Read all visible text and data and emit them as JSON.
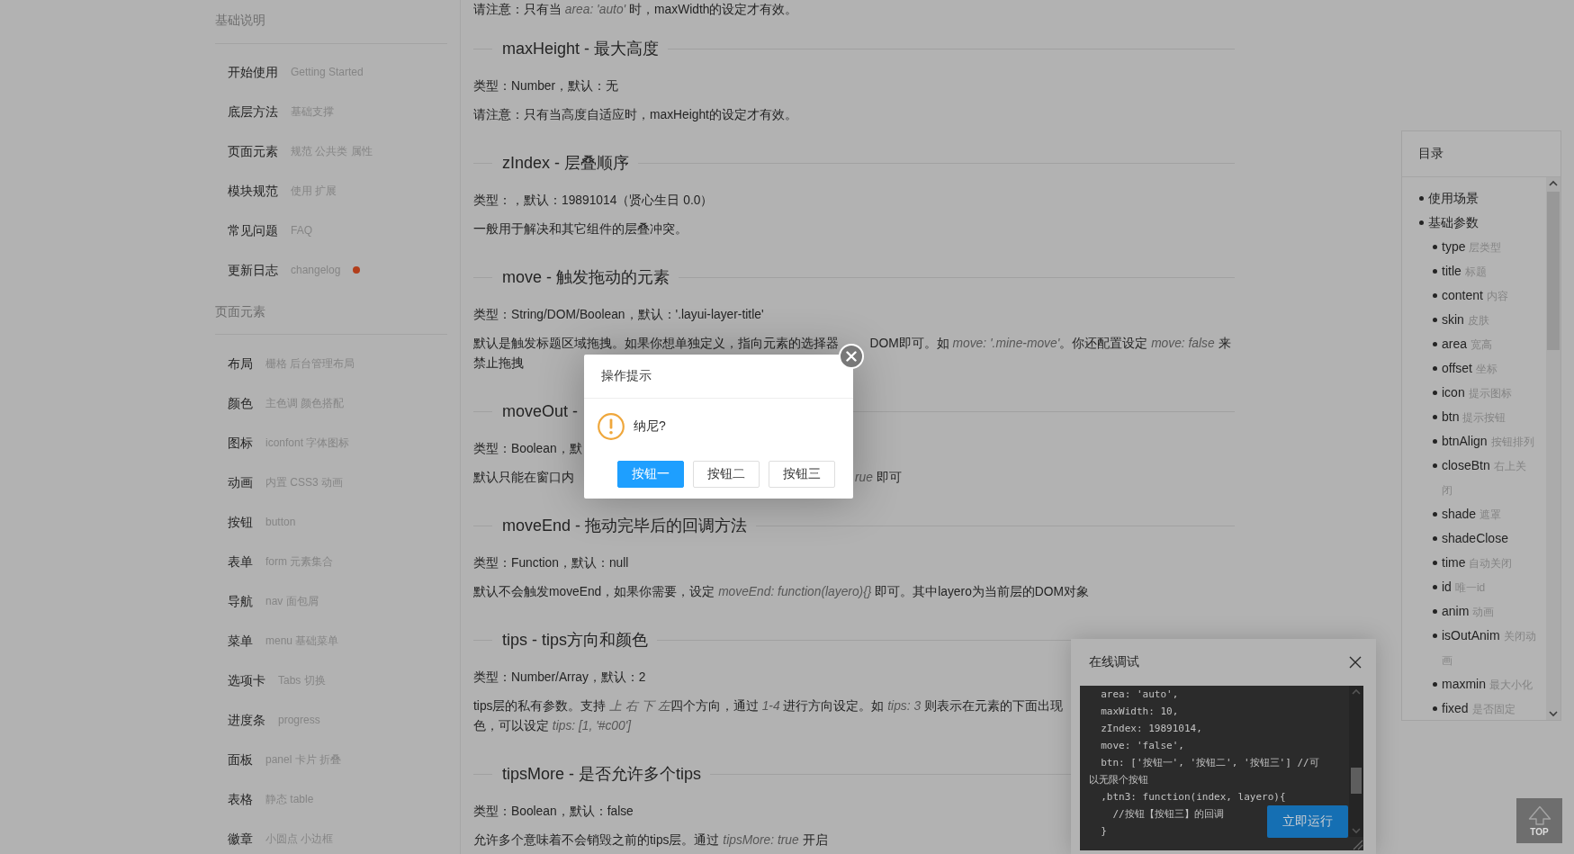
{
  "sidebar": {
    "groups": [
      {
        "title": "基础说明",
        "items": [
          {
            "label": "开始使用",
            "hint": "Getting Started",
            "dot": false
          },
          {
            "label": "底层方法",
            "hint": "基础支撑",
            "dot": false
          },
          {
            "label": "页面元素",
            "hint": "规范 公共类 属性",
            "dot": false
          },
          {
            "label": "模块规范",
            "hint": "使用 扩展",
            "dot": false
          },
          {
            "label": "常见问题",
            "hint": "FAQ",
            "dot": false
          },
          {
            "label": "更新日志",
            "hint": "changelog",
            "dot": true
          }
        ]
      },
      {
        "title": "页面元素",
        "items": [
          {
            "label": "布局",
            "hint": "栅格 后台管理布局",
            "dot": false
          },
          {
            "label": "颜色",
            "hint": "主色调 颜色搭配",
            "dot": false
          },
          {
            "label": "图标",
            "hint": "iconfont 字体图标",
            "dot": false
          },
          {
            "label": "动画",
            "hint": "内置 CSS3 动画",
            "dot": false
          },
          {
            "label": "按钮",
            "hint": "button",
            "dot": false
          },
          {
            "label": "表单",
            "hint": "form 元素集合",
            "dot": false
          },
          {
            "label": "导航",
            "hint": "nav 面包屑",
            "dot": false
          },
          {
            "label": "菜单",
            "hint": "menu 基础菜单",
            "dot": false
          },
          {
            "label": "选项卡",
            "hint": "Tabs 切换",
            "dot": false
          },
          {
            "label": "进度条",
            "hint": "progress",
            "dot": false
          },
          {
            "label": "面板",
            "hint": "panel 卡片 折叠",
            "dot": false
          },
          {
            "label": "表格",
            "hint": "静态 table",
            "dot": false
          },
          {
            "label": "徽章",
            "hint": "小圆点 小边框",
            "dot": false
          }
        ]
      }
    ]
  },
  "content": {
    "blocks": [
      {
        "kind": "paragraph",
        "text": "请注意：只有当 *area: 'auto'* 时，maxWidth的设定才有效。"
      },
      {
        "kind": "heading",
        "text": "maxHeight - 最大高度"
      },
      {
        "kind": "paragraph",
        "text": "类型：Number，默认：无"
      },
      {
        "kind": "paragraph",
        "text": "请注意：只有当高度自适应时，maxHeight的设定才有效。"
      },
      {
        "kind": "heading",
        "text": "zIndex - 层叠顺序"
      },
      {
        "kind": "paragraph",
        "text": "类型：，默认：19891014（贤心生日 0.0）"
      },
      {
        "kind": "paragraph",
        "text": "一般用于解决和其它组件的层叠冲突。"
      },
      {
        "kind": "heading",
        "text": "move - 触发拖动的元素"
      },
      {
        "kind": "paragraph",
        "text": "类型：String/DOM/Boolean，默认：'.layui-layer-title'"
      },
      {
        "kind": "rows",
        "rows": [
          [
            "默认是触发标题区域拖拽。如果你想单独定义，指向元素的选择器",
            "DOM即可。如 *move: '.mine-move'*。你还配置设定 *move: false* 来"
          ],
          [
            "禁止拖拽"
          ]
        ]
      },
      {
        "kind": "heading",
        "text": "moveOut -"
      },
      {
        "kind": "paragraph",
        "text": "类型：Boolean，默"
      },
      {
        "kind": "split",
        "parts": [
          "默认只能在窗口内",
          "*rue* 即可"
        ]
      },
      {
        "kind": "heading",
        "text": "moveEnd - 拖动完毕后的回调方法"
      },
      {
        "kind": "paragraph",
        "text": "类型：Function，默认：null"
      },
      {
        "kind": "paragraph",
        "text": "默认不会触发moveEnd，如果你需要，设定 *moveEnd: function(layero){}* 即可。其中layero为当前层的DOM对象"
      },
      {
        "kind": "heading",
        "text": "tips - tips方向和颜色"
      },
      {
        "kind": "paragraph",
        "text": "类型：Number/Array，默认：2"
      },
      {
        "kind": "paragraph",
        "lines": [
          [
            "tips层的私有参数。支持 ",
            "*上 右 下 左*",
            "四个方向，通过 *1-4* 进行方向设定。如 *tips: 3* 则表示在元素的下面出现"
          ],
          [
            "色，可以设定 *tips: [1, '#c00']*"
          ]
        ]
      },
      {
        "kind": "heading",
        "text": "tipsMore - 是否允许多个tips"
      },
      {
        "kind": "paragraph",
        "text": "类型：Boolean，默认：false"
      },
      {
        "kind": "paragraph",
        "text": "允许多个意味着不会销毁之前的tips层。通过 *tipsMore: true* 开启"
      }
    ]
  },
  "toc": {
    "title": "目录",
    "items": [
      {
        "label": "使用场景"
      },
      {
        "label": "基础参数",
        "children": [
          {
            "label": "type",
            "hint": "层类型"
          },
          {
            "label": "title",
            "hint": "标题"
          },
          {
            "label": "content",
            "hint": "内容"
          },
          {
            "label": "skin",
            "hint": "皮肤"
          },
          {
            "label": "area",
            "hint": "宽高"
          },
          {
            "label": "offset",
            "hint": "坐标"
          },
          {
            "label": "icon",
            "hint": "提示图标"
          },
          {
            "label": "btn",
            "hint": "提示按钮"
          },
          {
            "label": "btnAlign",
            "hint": "按钮排列"
          },
          {
            "label": "closeBtn",
            "hint": "右上关闭"
          },
          {
            "label": "shade",
            "hint": "遮罩"
          },
          {
            "label": "shadeClose"
          },
          {
            "label": "time",
            "hint": "自动关闭"
          },
          {
            "label": "id",
            "hint": "唯一id"
          },
          {
            "label": "anim",
            "hint": "动画"
          },
          {
            "label": "isOutAnim",
            "hint": "关闭动画"
          },
          {
            "label": "maxmin",
            "hint": "最大小化"
          },
          {
            "label": "fixed",
            "hint": "是否固定"
          }
        ]
      }
    ]
  },
  "dialog": {
    "title": "操作提示",
    "message": "纳尼?",
    "buttons": [
      {
        "label": "按钮一",
        "primary": true
      },
      {
        "label": "按钮二",
        "primary": false
      },
      {
        "label": "按钮三",
        "primary": false
      }
    ]
  },
  "debug_panel": {
    "title": "在线调试",
    "code": "  area: 'auto',\n  maxWidth: 10,\n  zIndex: 19891014,\n  move: 'false',\n  btn: ['按钮一', '按钮二', '按钮三'] //可以无限个按钮\n  ,btn3: function(index, layero){\n    //按钮【按钮三】的回调\n  }",
    "run_button": "立即运行"
  },
  "back_to_top": {
    "label": "TOP"
  }
}
